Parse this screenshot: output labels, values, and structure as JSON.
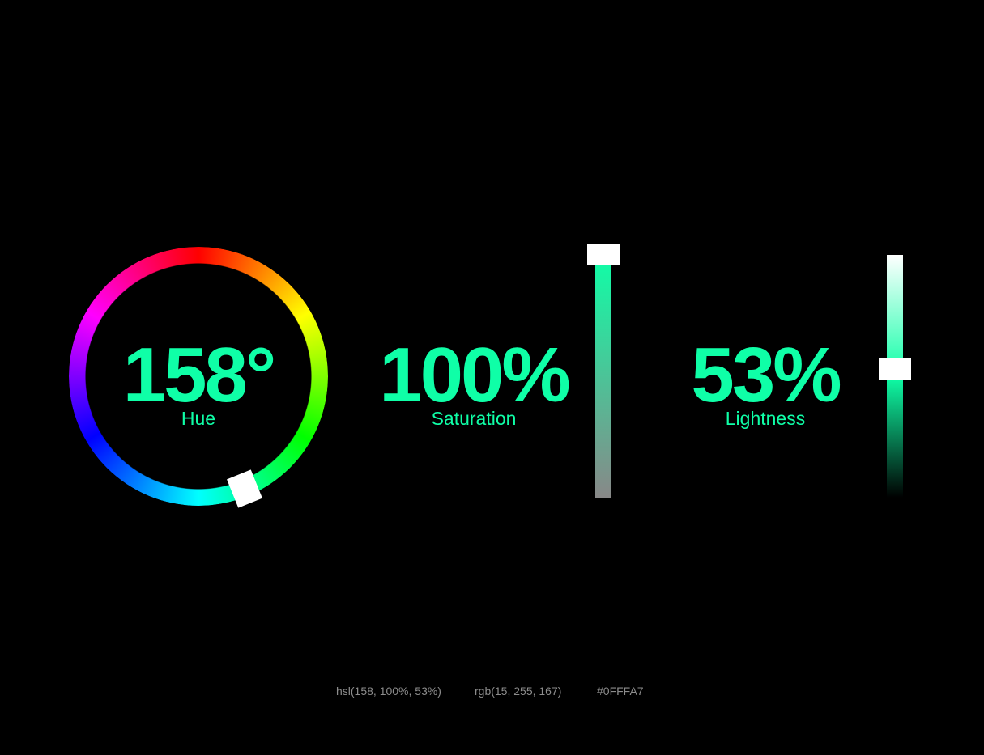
{
  "colors": {
    "accent": "#0FFFA7",
    "background": "#000000",
    "thumb": "#FFFFFF",
    "readout_text": "#8C8C8C"
  },
  "hue": {
    "value_text": "158°",
    "label": "Hue",
    "degrees": 158
  },
  "saturation": {
    "value_text": "100%",
    "label": "Saturation",
    "level": 1.0
  },
  "lightness": {
    "value_text": "53%",
    "label": "Lightness",
    "level": 0.53
  },
  "readouts": {
    "hsl": "hsl(158, 100%, 53%)",
    "rgb": "rgb(15, 255, 167)",
    "hex": "#0FFFA7"
  }
}
